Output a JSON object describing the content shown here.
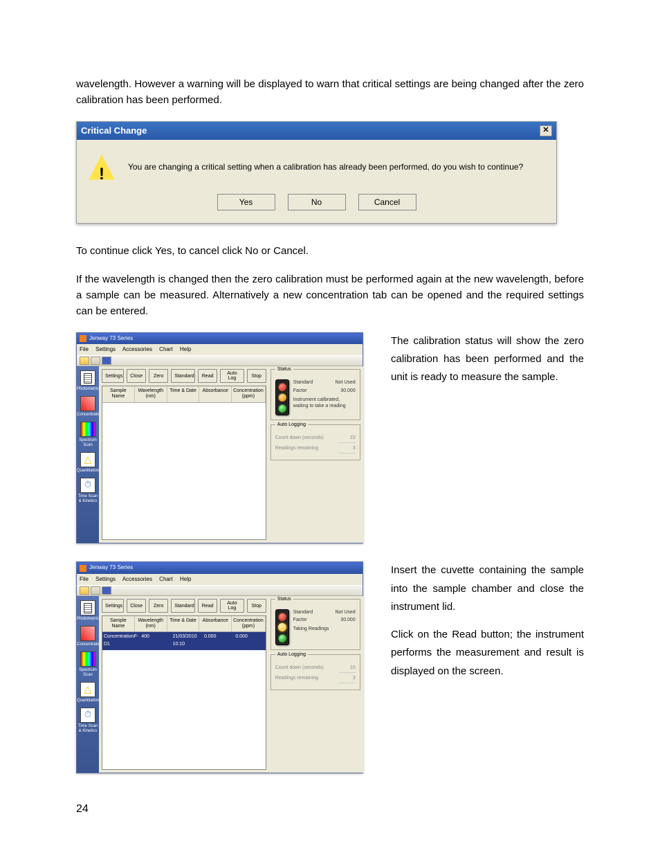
{
  "paragraphs": {
    "intro": "wavelength. However a warning will be displayed to warn that critical settings are being changed after the zero calibration has been performed.",
    "after_dialog_1": "To continue click Yes, to cancel click No or Cancel.",
    "after_dialog_2": "If the wavelength is changed then the zero calibration must be performed again at the new wavelength, before a sample can be measured. Alternatively a new concentration tab can be opened and the required settings can be entered.",
    "right1": "The calibration status will show the zero calibration has been performed and the unit is ready to measure the sample.",
    "right2a": "Insert the cuvette containing the sample into the sample chamber and close the instrument lid.",
    "right2b": "Click on the Read button; the instrument performs the measurement and result is displayed on the screen."
  },
  "dialog": {
    "title": "Critical Change",
    "message": "You are changing a critical setting when a calibration has already been performed, do you wish to continue?",
    "yes": "Yes",
    "no": "No",
    "cancel": "Cancel"
  },
  "app": {
    "title": "Jenway 73 Series",
    "menus": [
      "File",
      "Settings",
      "Accessories",
      "Chart",
      "Help"
    ],
    "sidebar": [
      {
        "label": "Photometrics",
        "icon": "ico-doc"
      },
      {
        "label": "Concentration",
        "icon": "ico-conc"
      },
      {
        "label": "Spectrum Scan",
        "icon": "ico-spec"
      },
      {
        "label": "Quantitation",
        "icon": "ico-quant"
      },
      {
        "label": "Time Scan & Kinetics",
        "icon": "ico-time"
      }
    ],
    "buttons": [
      "Settings",
      "Close",
      "Zero",
      "Standard",
      "Read",
      "Auto Log",
      "Stop"
    ],
    "columns": [
      "Sample Name",
      "Wavelength (nm)",
      "Time & Date",
      "Absorbance",
      "Concentration (ppm)"
    ],
    "status_group": "Status",
    "autolog_group": "Auto Logging",
    "standard_label": "Standard",
    "standard_value": "Not Used",
    "factor_label": "Factor",
    "factor_value": "30.000",
    "countdown_label": "Count down (seconds)",
    "countdown_value": "10",
    "remaining_label": "Readings remaining",
    "remaining_value": "3"
  },
  "shot1": {
    "status_msg": "Instrument calibrated, waiting to take a reading"
  },
  "shot2": {
    "status_msg": "Taking Readings",
    "row": {
      "sample": "ConcentrationF-D1",
      "wavelength": "400",
      "datetime": "21/03/2010 10:10",
      "abs": "0.000",
      "conc": "0.000"
    }
  },
  "page_number": "24"
}
